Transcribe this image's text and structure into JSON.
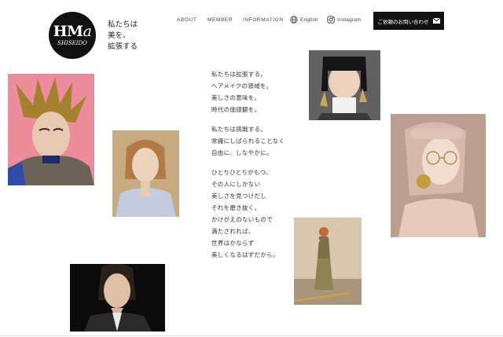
{
  "brand": {
    "logo_main": "HM",
    "logo_accent": "a",
    "logo_sub": "SHISEIDO",
    "tagline": [
      "私たちは",
      "美を、",
      "拡張する"
    ]
  },
  "nav": {
    "about": "ABOUT",
    "member": "MEMBER",
    "information": "INFORMATION",
    "english": "English",
    "instagram": "Instagram",
    "contact": "ご依頼のお問い合わせ"
  },
  "icons": {
    "globe": "globe-icon",
    "instagram": "instagram-icon",
    "mail": "mail-icon"
  },
  "poem": {
    "stanza1": [
      "私たちは拡張する。",
      "ヘアメイクの領域を。",
      "美しさの意味を。",
      "時代の価値観を。"
    ],
    "stanza2": [
      "私たちは挑戦する。",
      "常識にしばられることなく",
      "自由に、しなやかに。"
    ],
    "stanza3": [
      "ひとりひとりがもつ、",
      "その人にしかない",
      "美しさを見つけだし",
      "それを磨き抜く。",
      "かけがえのないもので",
      "満たされれば、",
      "世界はかならず",
      "美しくなるはずだから。"
    ]
  }
}
